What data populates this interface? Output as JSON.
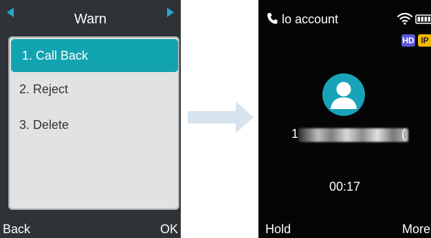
{
  "left_screen": {
    "title": "Warn",
    "menu_items": [
      "1. Call Back",
      "2. Reject",
      "3. Delete"
    ],
    "selected_index": 0,
    "softkeys": {
      "left": "Back",
      "right": "OK"
    }
  },
  "right_screen": {
    "status": {
      "account_text": "lo account"
    },
    "badges": {
      "hd": "HD",
      "ip": "IP"
    },
    "caller": {
      "prefix": "1",
      "suffix": "("
    },
    "timer": "00:17",
    "softkeys": {
      "left": "Hold",
      "right": "More"
    }
  },
  "colors": {
    "left_bg": "#2d3337",
    "highlight": "#12a3b1",
    "menu_bg": "#e1e2e2",
    "nav_arrows": "#27a5ce",
    "right_bg": "#050505",
    "avatar": "#19a3b8",
    "arrow": "#d7e4ef",
    "badge_hd": "#5b57d6",
    "badge_ip": "#f2b705"
  },
  "icons": {
    "left_nav": "triangle-left-icon",
    "right_nav": "triangle-right-icon",
    "phone": "phone-handset-icon",
    "wifi": "wifi-icon",
    "battery": "battery-icon",
    "avatar": "person-avatar-icon",
    "transition": "arrow-right-icon"
  }
}
